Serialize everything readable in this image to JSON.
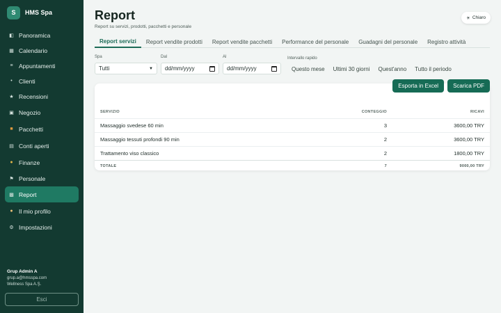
{
  "sidebar": {
    "brand_initial": "S",
    "brand_name": "HMS Spa",
    "items": [
      {
        "label": "Panoramica",
        "icon": "grid-icon"
      },
      {
        "label": "Calendario",
        "icon": "calendar-icon"
      },
      {
        "label": "Appuntamenti",
        "icon": "list-icon"
      },
      {
        "label": "Clienti",
        "icon": "dot-icon"
      },
      {
        "label": "Recensioni",
        "icon": "star-icon"
      },
      {
        "label": "Negozio",
        "icon": "cart-icon"
      },
      {
        "label": "Pacchetti",
        "icon": "package-icon"
      },
      {
        "label": "Conti aperti",
        "icon": "receipt-icon"
      },
      {
        "label": "Finanze",
        "icon": "money-bag-icon"
      },
      {
        "label": "Personale",
        "icon": "flag-icon"
      },
      {
        "label": "Report",
        "icon": "chart-icon",
        "active": true
      },
      {
        "label": "Il mio profilo",
        "icon": "user-icon"
      },
      {
        "label": "Impostazioni",
        "icon": "gear-icon"
      }
    ],
    "user": {
      "name": "Grup Admin A",
      "email": "grup.a@hmsspa.com",
      "company": "Wellness Spa A.Ş."
    },
    "logout_label": "Esci"
  },
  "header": {
    "title": "Report",
    "subtitle": "Report su servizi, prodotti, pacchetti e personale",
    "theme_label": "Chiaro"
  },
  "tabs": [
    {
      "label": "Report servizi",
      "active": true
    },
    {
      "label": "Report vendite prodotti"
    },
    {
      "label": "Report vendite pacchetti"
    },
    {
      "label": "Performance del personale"
    },
    {
      "label": "Guadagni del personale"
    },
    {
      "label": "Registro attività"
    }
  ],
  "filters": {
    "spa_label": "Spa",
    "spa_value": "Tutti",
    "from_label": "Dal",
    "from_value": "dd/mm/yyyy",
    "to_label": "Al",
    "to_value": "dd/mm/yyyy",
    "quick_label": "Intervallo rapido",
    "quick_options": [
      "Questo mese",
      "Ultimi 30 giorni",
      "Quest'anno",
      "Tutto il periodo"
    ]
  },
  "actions": {
    "excel_label": "Esporta in Excel",
    "pdf_label": "Scarica PDF"
  },
  "table": {
    "headers": [
      "SERVIZIO",
      "CONTEGGIO",
      "RICAVI"
    ],
    "rows": [
      [
        "Massaggio svedese 60 min",
        "3",
        "3600,00 TRY"
      ],
      [
        "Massaggio tessuti profondi 90 min",
        "2",
        "3600,00 TRY"
      ],
      [
        "Trattamento viso classico",
        "2",
        "1800,00 TRY"
      ]
    ],
    "total": [
      "TOTALE",
      "7",
      "9000,00 TRY"
    ]
  },
  "colors": {
    "sidebar_bg": "#133a31",
    "accent": "#166b55",
    "active_nav": "#1f7a63"
  }
}
